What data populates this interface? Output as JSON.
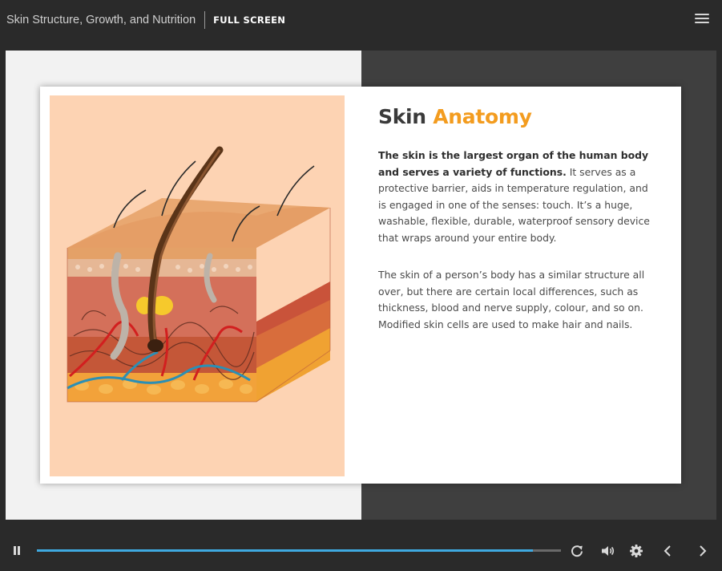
{
  "header": {
    "course_title": "Skin Structure, Growth, and Nutrition",
    "fullscreen_label": "FULL SCREEN",
    "menu_icon": "hamburger-menu-icon"
  },
  "slide": {
    "heading_plain": "Skin ",
    "heading_accent": "Anatomy",
    "paragraph1_bold": "The skin is the largest organ of the human body and serves a variety of functions.",
    "paragraph1_rest": " It serves as a protective barrier, aids in temperature regulation, and is engaged in one of the senses: touch. It’s a huge, washable, flexible, durable, waterproof sensory device that wraps around your entire body.",
    "paragraph2": "The skin of a person’s body has a similar structure all over, but there are certain local differences, such as thickness, blood and nerve supply, colour, and so on. Modified skin cells are used to make hair and nails.",
    "illustration": "skin-cross-section-illustration"
  },
  "player": {
    "progress_fraction": 0.947,
    "icons": [
      "pause-icon",
      "replay-icon",
      "volume-icon",
      "settings-gear-icon",
      "chevron-left-icon",
      "chevron-right-icon"
    ]
  },
  "colors": {
    "accent": "#f39c1f",
    "progress": "#3fa9e0",
    "chrome_bg": "#2a2a2a"
  }
}
